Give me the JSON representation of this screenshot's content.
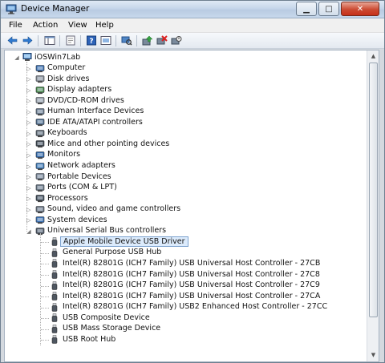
{
  "window": {
    "title": "Device Manager"
  },
  "menubar": {
    "items": [
      "File",
      "Action",
      "View",
      "Help"
    ]
  },
  "toolbar": {
    "buttons": [
      "back-arrow-icon",
      "forward-arrow-icon",
      "show-hide-console-tree-icon",
      "properties-icon",
      "help-icon",
      "view-icon",
      "update-driver-icon",
      "uninstall-icon",
      "scan-hardware-changes-icon"
    ]
  },
  "tree": {
    "root": "iOSWin7Lab",
    "categories": [
      {
        "label": "Computer",
        "icon": "computer-icon"
      },
      {
        "label": "Disk drives",
        "icon": "disk-drive-icon"
      },
      {
        "label": "Display adapters",
        "icon": "display-adapter-icon"
      },
      {
        "label": "DVD/CD-ROM drives",
        "icon": "dvd-drive-icon"
      },
      {
        "label": "Human Interface Devices",
        "icon": "hid-icon"
      },
      {
        "label": "IDE ATA/ATAPI controllers",
        "icon": "ide-controller-icon"
      },
      {
        "label": "Keyboards",
        "icon": "keyboard-icon"
      },
      {
        "label": "Mice and other pointing devices",
        "icon": "mouse-icon"
      },
      {
        "label": "Monitors",
        "icon": "monitor-icon"
      },
      {
        "label": "Network adapters",
        "icon": "network-adapter-icon"
      },
      {
        "label": "Portable Devices",
        "icon": "portable-device-icon"
      },
      {
        "label": "Ports (COM & LPT)",
        "icon": "port-icon"
      },
      {
        "label": "Processors",
        "icon": "processor-icon"
      },
      {
        "label": "Sound, video and game controllers",
        "icon": "sound-icon"
      },
      {
        "label": "System devices",
        "icon": "system-device-icon"
      },
      {
        "label": "Universal Serial Bus controllers",
        "icon": "usb-icon"
      }
    ],
    "usb_children": [
      "Apple Mobile Device USB Driver",
      "General Purpose USB Hub",
      "Intel(R) 82801G (ICH7 Family) USB Universal Host Controller - 27CB",
      "Intel(R) 82801G (ICH7 Family) USB Universal Host Controller - 27C8",
      "Intel(R) 82801G (ICH7 Family) USB Universal Host Controller - 27C9",
      "Intel(R) 82801G (ICH7 Family) USB Universal Host Controller - 27CA",
      "Intel(R) 82801G (ICH7 Family) USB2 Enhanced Host Controller - 27CC",
      "USB Composite Device",
      "USB Mass Storage Device",
      "USB Root Hub"
    ],
    "selected_child": "Apple Mobile Device USB Driver"
  },
  "colors": {
    "selection_bg": "#dcebfc",
    "selection_border": "#7da2ce",
    "close_button": "#cc4b32"
  }
}
